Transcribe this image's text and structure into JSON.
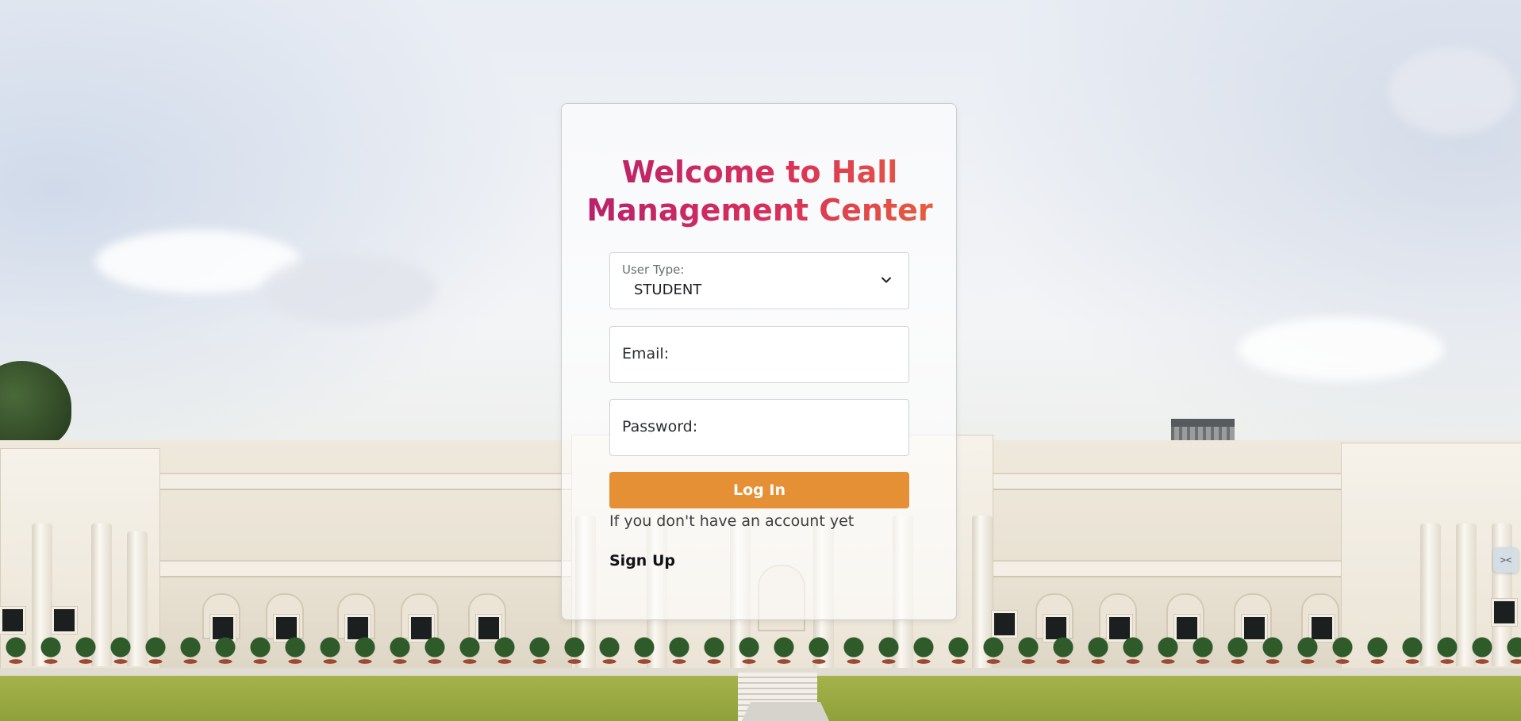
{
  "login": {
    "title_line1": "Welcome to Hall",
    "title_line2": "Management Center",
    "user_type": {
      "label": "User Type:",
      "selected": "STUDENT"
    },
    "email": {
      "placeholder": "Email:"
    },
    "password": {
      "placeholder": "Password:"
    },
    "login_button": "Log In",
    "signup_hint": "If you don't have an account yet",
    "signup_link": "Sign Up"
  },
  "colors": {
    "title_gradient_start": "#b4206c",
    "title_gradient_end": "#e8653a",
    "button": "#e69035"
  },
  "icons": {
    "select_chevron": "chevron-down-icon"
  }
}
